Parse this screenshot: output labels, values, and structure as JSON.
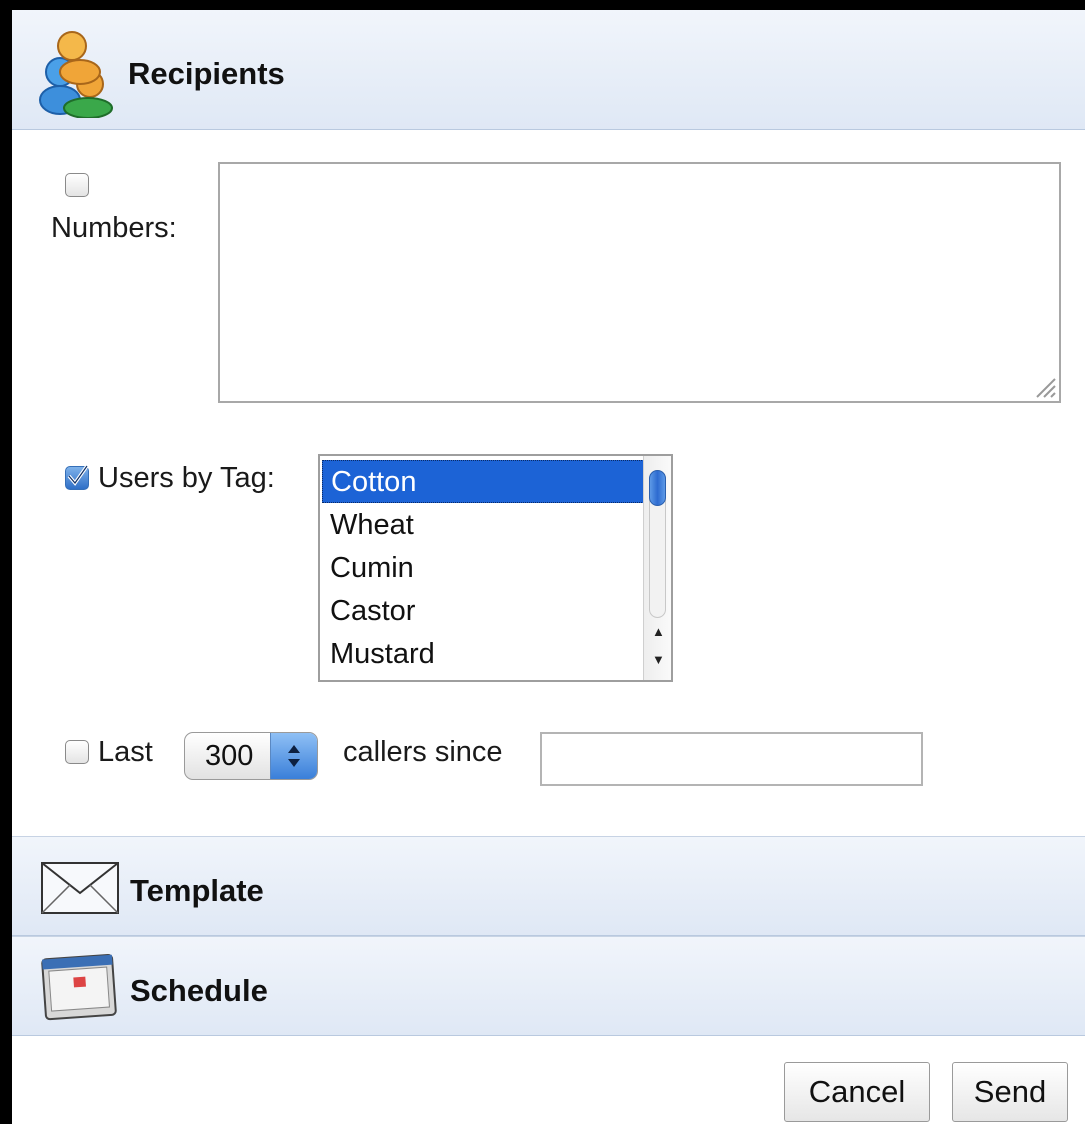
{
  "sections": {
    "recipients": {
      "title": "Recipients",
      "icon": "users-icon"
    },
    "template": {
      "title": "Template",
      "icon": "envelope-icon"
    },
    "schedule": {
      "title": "Schedule",
      "icon": "calendar-icon"
    }
  },
  "recipients": {
    "numbers": {
      "label": "Numbers:",
      "checked": false,
      "value": ""
    },
    "users_by_tag": {
      "label": "Users by Tag:",
      "checked": true,
      "options": [
        "Cotton",
        "Wheat",
        "Cumin",
        "Castor",
        "Mustard"
      ],
      "selected": "Cotton"
    },
    "last_callers": {
      "checked": false,
      "label_prefix": "Last",
      "count": "300",
      "label_suffix": "callers since",
      "since_value": ""
    }
  },
  "actions": {
    "cancel": "Cancel",
    "send": "Send"
  },
  "colors": {
    "selection": "#1c63d6",
    "header": "#dfe8f5"
  }
}
